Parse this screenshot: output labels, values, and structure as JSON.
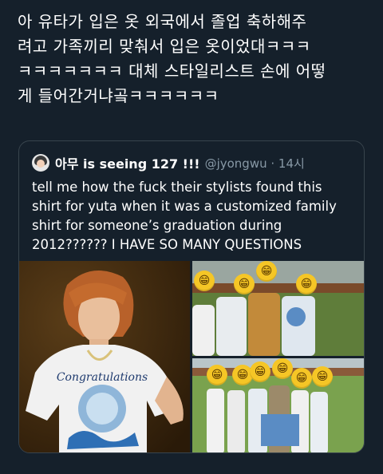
{
  "tweet": {
    "text": "아 유타가 입은 옷 외국에서 졸업 축하해주\n려고 가족끼리 맞춰서 입은 옷이었대ㅋㅋㅋ\nㅋㅋㅋㅋㅋㅋㅋ 대체 스타일리스트 손에 어떻\n게 들어간거냐곸ㅋㅋㅋㅋㅋㅋ"
  },
  "quote": {
    "display_name": "아무 is seeing 127 !!!",
    "handle_time": "@jyongwu · 14시",
    "text": "tell me how the fuck their stylists found this shirt for yuta when it was a customized family shirt for someone’s graduation during 2012?????? I HAVE SO MANY QUESTIONS",
    "shirt_print": "Congratulations"
  },
  "emoji_face": "😁",
  "colors": {
    "background": "#15202b",
    "border": "#38444d",
    "secondary_text": "#8899a6",
    "emoji": "#f5c626"
  },
  "icons": [
    "user-avatar",
    "grinning-face-emoji"
  ]
}
